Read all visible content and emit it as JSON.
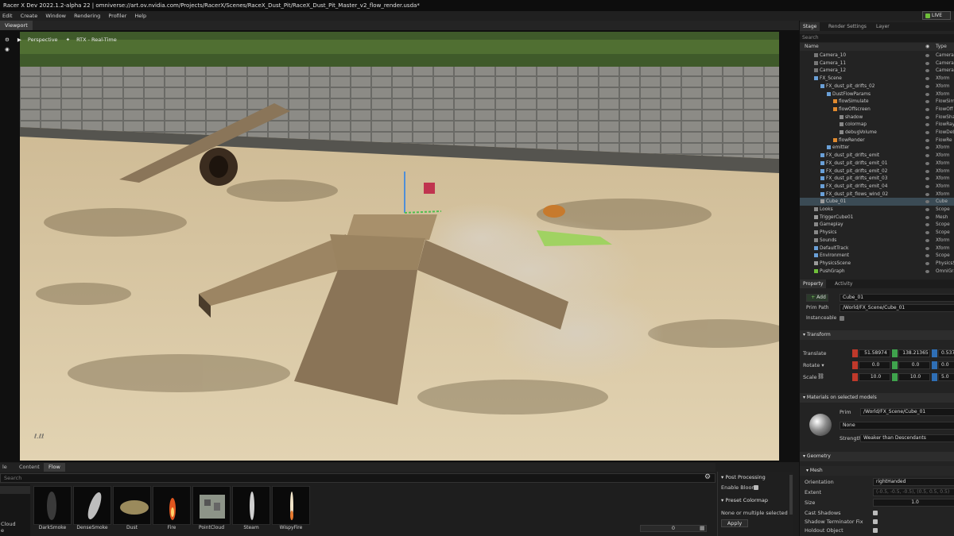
{
  "window": {
    "title": "Racer X Dev 2022.1.2-alpha 22  |  omniverse://art.ov.nvidia.com/Projects/RacerX/Scenes/RaceX_Dust_Pit/RaceX_Dust_Pit_Master_v2_flow_render.usda*",
    "live_label": "LIVE"
  },
  "menu": [
    "Edit",
    "Create",
    "Window",
    "Rendering",
    "Profiler",
    "Help"
  ],
  "viewport": {
    "tab": "Viewport",
    "camera": "Perspective",
    "renderer": "RTX - Real-Time",
    "watermark": "ℓ.ℓℓ"
  },
  "bottom": {
    "tabs": [
      "le",
      "Content",
      "Flow"
    ],
    "search_placeholder": "Search",
    "left_items": [
      "Cloud",
      "e"
    ],
    "assets": [
      "DarkSmoke",
      "DenseSmoke",
      "Dust",
      "Fire",
      "PointCloud",
      "Steam",
      "WispyFire"
    ],
    "post_processing": "Post Processing",
    "enable_bloom": "Enable Bloom",
    "preset_colormap": "Preset Colormap",
    "none_or_multiple": "None or multiple selected",
    "apply": "Apply",
    "slider_value": "0"
  },
  "stage": {
    "tabs": [
      "Stage",
      "Render Settings",
      "Layer"
    ],
    "search_placeholder": "Search",
    "col_name": "Name",
    "col_type": "Type",
    "rows": [
      {
        "name": "Camera_10",
        "type": "Camera"
      },
      {
        "name": "Camera_11",
        "type": "Camera"
      },
      {
        "name": "Camera_12",
        "type": "Camera"
      },
      {
        "name": "FX_Scene",
        "type": "Xform"
      },
      {
        "name": "FX_dust_pit_drifts_02",
        "type": "Xform"
      },
      {
        "name": "DustFlowParams",
        "type": "Xform"
      },
      {
        "name": "flowSimulate",
        "type": "FlowSim"
      },
      {
        "name": "flowOffscreen",
        "type": "FlowOff"
      },
      {
        "name": "shadow",
        "type": "FlowSha"
      },
      {
        "name": "colormap",
        "type": "FlowRay"
      },
      {
        "name": "debugVolume",
        "type": "FlowDeb"
      },
      {
        "name": "flowRender",
        "type": "FlowRe"
      },
      {
        "name": "emitter",
        "type": "Xform"
      },
      {
        "name": "FX_dust_pit_drifts_emit",
        "type": "Xform"
      },
      {
        "name": "FX_dust_pit_drifts_emit_01",
        "type": "Xform"
      },
      {
        "name": "FX_dust_pit_drifts_emit_02",
        "type": "Xform"
      },
      {
        "name": "FX_dust_pit_drifts_emit_03",
        "type": "Xform"
      },
      {
        "name": "FX_dust_pit_drifts_emit_04",
        "type": "Xform"
      },
      {
        "name": "FX_dust_pit_flows_wind_02",
        "type": "Xform"
      },
      {
        "name": "Cube_01",
        "type": "Cube"
      },
      {
        "name": "Looks",
        "type": "Scope"
      },
      {
        "name": "TriggerCube01",
        "type": "Mesh"
      },
      {
        "name": "Gameplay",
        "type": "Scope"
      },
      {
        "name": "Physics",
        "type": "Scope"
      },
      {
        "name": "Sounds",
        "type": "Xform"
      },
      {
        "name": "DefaultTrack",
        "type": "Xform"
      },
      {
        "name": "Environment",
        "type": "Scope"
      },
      {
        "name": "PhysicsScene",
        "type": "PhysicsS"
      },
      {
        "name": "PushGraph",
        "type": "OmniGrap"
      }
    ]
  },
  "property": {
    "tabs": [
      "Property",
      "Activity"
    ],
    "add_label": "Add",
    "prim_name": "Cube_01",
    "prim_path_label": "Prim Path",
    "prim_path": "/World/FX_Scene/Cube_01",
    "instanceable_label": "Instanceable",
    "transform_label": "Transform",
    "translate_label": "Translate",
    "rotate_label": "Rotate ▾",
    "scale_label": "Scale",
    "translate": [
      "51.58974",
      "138.21365",
      "0.537"
    ],
    "rotate": [
      "0.0",
      "0.0",
      "0.0"
    ],
    "scale": [
      "10.0",
      "10.0",
      "5.0"
    ],
    "materials_label": "Materials on selected models",
    "prim_label": "Prim",
    "material_prim": "/World/FX_Scene/Cube_01",
    "material_value": "None",
    "strength_label": "Strength",
    "strength_value": "Weaker than Descendants",
    "geometry_label": "Geometry",
    "mesh_label": "Mesh",
    "orientation_label": "Orientation",
    "orientation": "rightHanded",
    "extent_label": "Extent",
    "extent": "(-0.5, -0.5, -0.5), (0.5, 0.5, 0.5)",
    "size_label": "Size",
    "size": "1.0",
    "cast_shadows": "Cast Shadows",
    "shadow_terminator": "Shadow Terminator Fix",
    "holdout": "Holdout Object"
  },
  "colors": {
    "selection": "#3b4b55",
    "accent_green": "#6fbf3a",
    "x": "#c0392b",
    "y": "#3fa34d",
    "z": "#2f6fb5"
  }
}
